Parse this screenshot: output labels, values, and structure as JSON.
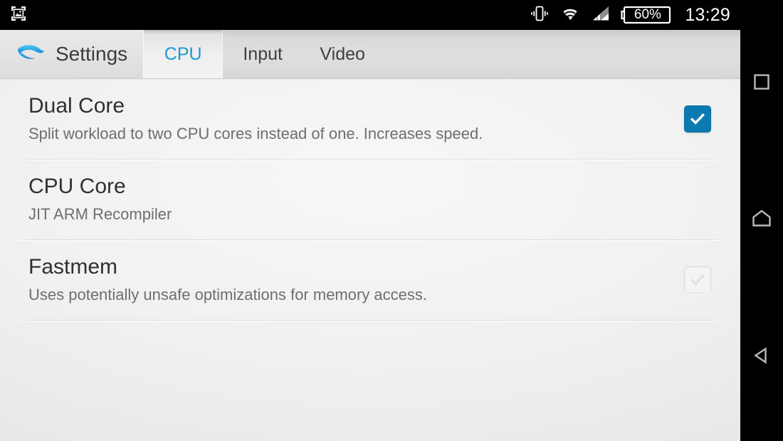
{
  "statusbar": {
    "notification_icon": "screenshot-icon",
    "icons": [
      "vibrate-icon",
      "wifi-icon",
      "signal-icon"
    ],
    "battery_level": "60%",
    "time": "13:29"
  },
  "appbar": {
    "logo": "dolphin-logo",
    "title": "Settings",
    "tabs": [
      {
        "label": "CPU",
        "active": true
      },
      {
        "label": "Input",
        "active": false
      },
      {
        "label": "Video",
        "active": false
      }
    ]
  },
  "settings": {
    "items": [
      {
        "title": "Dual Core",
        "subtitle": "Split workload to two CPU cores instead of one. Increases speed.",
        "control": "checkbox",
        "checked": true
      },
      {
        "title": "CPU Core",
        "subtitle": "JIT ARM Recompiler",
        "control": "none",
        "checked": false
      },
      {
        "title": "Fastmem",
        "subtitle": "Uses potentially unsafe optimizations for memory access.",
        "control": "checkbox",
        "checked": false
      }
    ]
  },
  "navbar": {
    "buttons": [
      {
        "name": "recents-icon"
      },
      {
        "name": "home-icon"
      },
      {
        "name": "back-icon"
      }
    ]
  },
  "colors": {
    "accent_blue": "#1a9ad4",
    "checkbox_on": "#0b7ab0",
    "statusbar_bg": "#000000"
  }
}
